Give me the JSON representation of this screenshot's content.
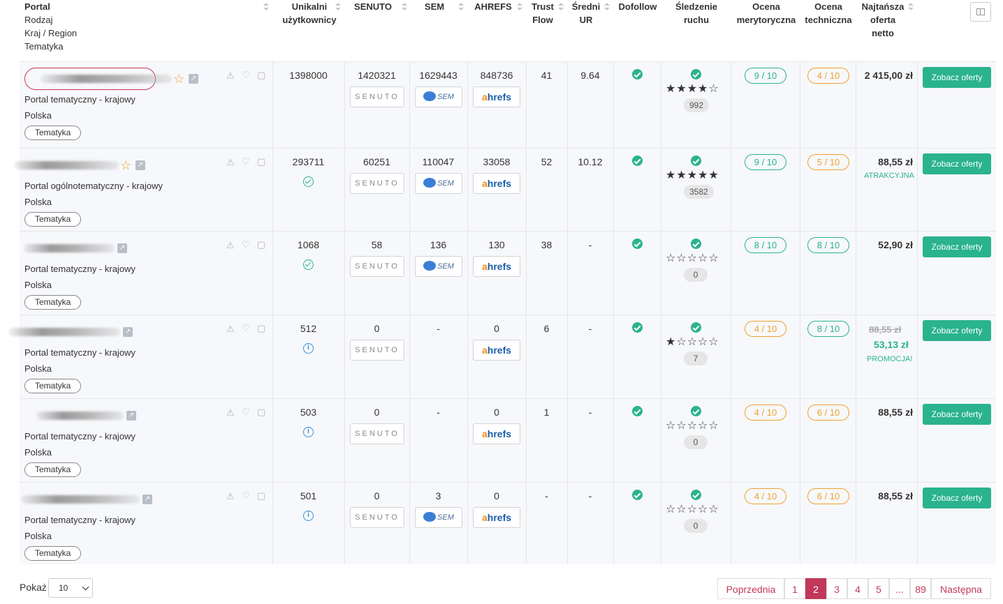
{
  "headers": {
    "portal": "Portal",
    "rodzaj": "Rodzaj",
    "kraj": "Kraj / Region",
    "tematyka": "Tematyka",
    "unikalni_1": "Unikalni",
    "unikalni_2": "użytkownicy",
    "senuto": "SENUTO",
    "sem": "SEM",
    "ahrefs": "AHREFS",
    "trust_1": "Trust",
    "trust_2": "Flow",
    "sredni_1": "Średni",
    "sredni_2": "UR",
    "dofollow": "Dofollow",
    "sledzenie_1": "Śledzenie",
    "sledzenie_2": "ruchu",
    "ocena_m_1": "Ocena",
    "ocena_m_2": "merytoryczna",
    "ocena_t_1": "Ocena",
    "ocena_t_2": "techniczna",
    "oferta_1": "Najtańsza",
    "oferta_2": "oferta",
    "oferta_3": "netto"
  },
  "brands": {
    "senuto": "SENUTO",
    "sem": "SEM",
    "ahrefs_a": "a",
    "ahrefs_rest": "hrefs"
  },
  "rows": [
    {
      "type": "Portal tematyczny - krajowy",
      "country": "Polska",
      "tag": "Tematyka",
      "users": "1398000",
      "senuto": "1420321",
      "sem": "1629443",
      "ahrefs": "848736",
      "tf": "41",
      "ur": "9.64",
      "stars": "★★★★☆",
      "traffic": "992",
      "merit": "9 / 10",
      "tech": "4 / 10",
      "price": "2 415,00 zł",
      "button": "Zobacz oferty"
    },
    {
      "type": "Portal ogólnotematyczny - krajowy",
      "country": "Polska",
      "tag": "Tematyka",
      "users": "293711",
      "senuto": "60251",
      "sem": "110047",
      "ahrefs": "33058",
      "tf": "52",
      "ur": "10.12",
      "stars": "★★★★★",
      "traffic": "3582",
      "merit": "9 / 10",
      "tech": "5 / 10",
      "price": "88,55 zł",
      "note": "ATRAKCYJNA",
      "button": "Zobacz oferty"
    },
    {
      "type": "Portal tematyczny - krajowy",
      "country": "Polska",
      "tag": "Tematyka",
      "users": "1068",
      "senuto": "58",
      "sem": "136",
      "ahrefs": "130",
      "tf": "38",
      "ur": "-",
      "stars": "☆☆☆☆☆",
      "traffic": "0",
      "merit": "8 / 10",
      "tech": "8 / 10",
      "price": "52,90 zł",
      "button": "Zobacz oferty"
    },
    {
      "type": "Portal tematyczny - krajowy",
      "country": "Polska",
      "tag": "Tematyka",
      "users": "512",
      "senuto": "0",
      "sem": "-",
      "ahrefs": "0",
      "tf": "6",
      "ur": "-",
      "stars": "★☆☆☆☆",
      "traffic": "7",
      "merit": "4 / 10",
      "tech": "8 / 10",
      "price_old": "88,55 zł",
      "price_promo": "53,13 zł",
      "note": "PROMOCJA!",
      "button": "Zobacz oferty"
    },
    {
      "type": "Portal tematyczny - krajowy",
      "country": "Polska",
      "tag": "Tematyka",
      "users": "503",
      "senuto": "0",
      "sem": "-",
      "ahrefs": "0",
      "tf": "1",
      "ur": "-",
      "stars": "☆☆☆☆☆",
      "traffic": "0",
      "merit": "4 / 10",
      "tech": "6 / 10",
      "price": "88,55 zł",
      "button": "Zobacz oferty"
    },
    {
      "type": "Portal tematyczny - krajowy",
      "country": "Polska",
      "tag": "Tematyka",
      "users": "501",
      "senuto": "0",
      "sem": "3",
      "ahrefs": "0",
      "tf": "-",
      "ur": "-",
      "stars": "☆☆☆☆☆",
      "traffic": "0",
      "merit": "4 / 10",
      "tech": "6 / 10",
      "price": "88,55 zł",
      "button": "Zobacz oferty"
    }
  ],
  "footer": {
    "show_label": "Pokaż",
    "page_size": "10",
    "prev": "Poprzednia",
    "pages": [
      "1",
      "2",
      "3",
      "4",
      "5",
      "...",
      "89"
    ],
    "next": "Następna"
  },
  "colors": {
    "accent": "#2ab38d",
    "brand": "#c0395a",
    "warning": "#f0a030"
  }
}
